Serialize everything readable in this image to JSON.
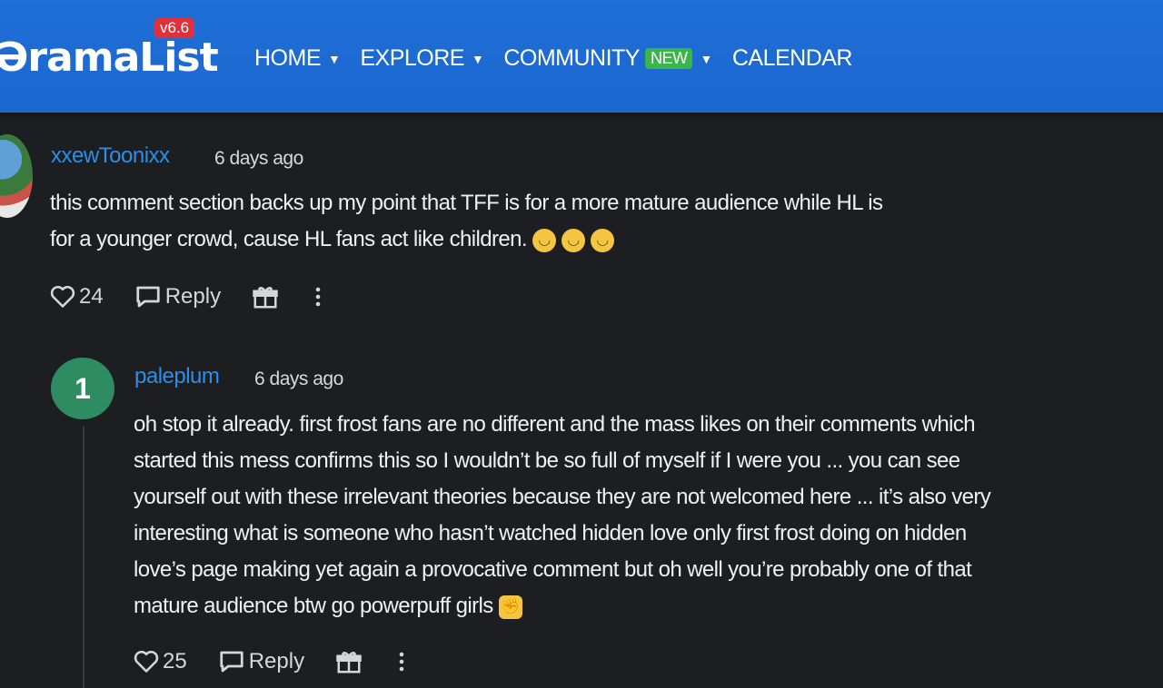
{
  "header": {
    "logo": "ƏramaList",
    "version": "v6.6",
    "nav": [
      {
        "label": "HOME",
        "caret": true
      },
      {
        "label": "EXPLORE",
        "caret": true
      },
      {
        "label": "COMMUNITY",
        "badge": "NEW",
        "caret": true
      },
      {
        "label": "CALENDAR",
        "caret": false
      }
    ]
  },
  "comments": [
    {
      "username": "xxewToonixx",
      "time": "6 days ago",
      "text_line1": "this comment section backs up my point that TFF is for a more mature audience while HL is",
      "text_line2": "for a younger crowd, cause HL fans act like children.",
      "likes": "24",
      "reply_label": "Reply"
    },
    {
      "rank": "1",
      "username": "paleplum",
      "time": "6 days ago",
      "text": "oh stop it already. first frost fans are no different and the mass likes on their comments which\nstarted this mess confirms this so I wouldn’t be so full of myself if I were you ... you can see\nyourself out with these irrelevant theories because they are not welcomed here ... it’s also very\ninteresting what is someone who hasn’t watched hidden love only first frost doing on hidden\nlove’s page making yet again a provocative comment but oh well you’re probably one of that\nmature audience btw go powerpuff girls",
      "likes": "25",
      "reply_label": "Reply"
    }
  ],
  "colors": {
    "header": "#1f6fd6",
    "username": "#2b8fe8",
    "badge_new": "#39b54a",
    "version": "#e0303a",
    "rank": "#2e8c62"
  }
}
